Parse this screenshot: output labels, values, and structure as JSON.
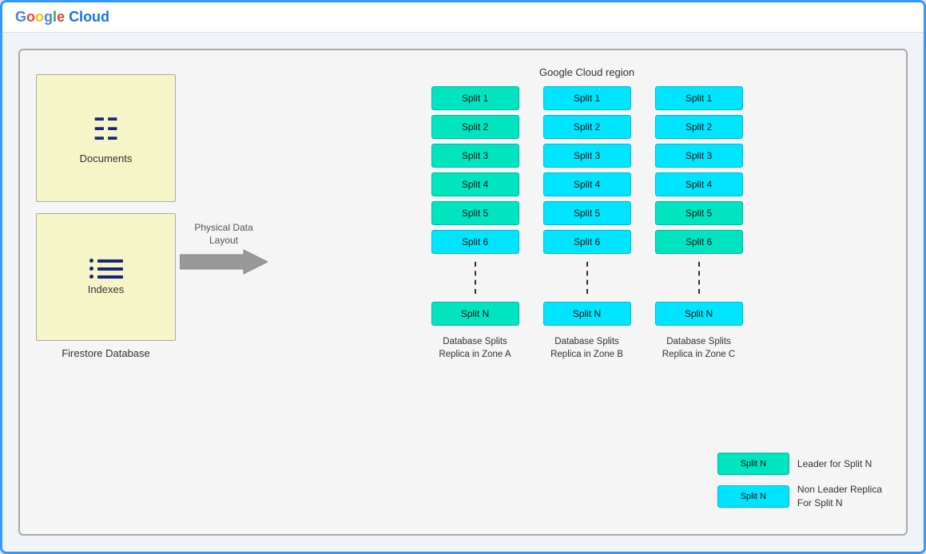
{
  "header": {
    "logo_google": "Google",
    "logo_cloud": "Cloud"
  },
  "diagram": {
    "region_label": "Google Cloud region",
    "firestore_label": "Firestore Database",
    "arrow_label": "Physical Data\nLayout",
    "documents_label": "Documents",
    "indexes_label": "Indexes",
    "zones": [
      {
        "name": "Database Splits\nReplica in Zone A"
      },
      {
        "name": "Database Splits\nReplica in Zone B"
      },
      {
        "name": "Database Splits\nReplica in Zone C"
      }
    ],
    "splits": [
      "Split 1",
      "Split 2",
      "Split 3",
      "Split 4",
      "Split 5",
      "Split 6",
      "Split N"
    ],
    "legend": [
      {
        "label": "Leader for Split N",
        "color": "green"
      },
      {
        "label": "Non Leader Replica\nFor Split N",
        "color": "cyan"
      }
    ]
  }
}
